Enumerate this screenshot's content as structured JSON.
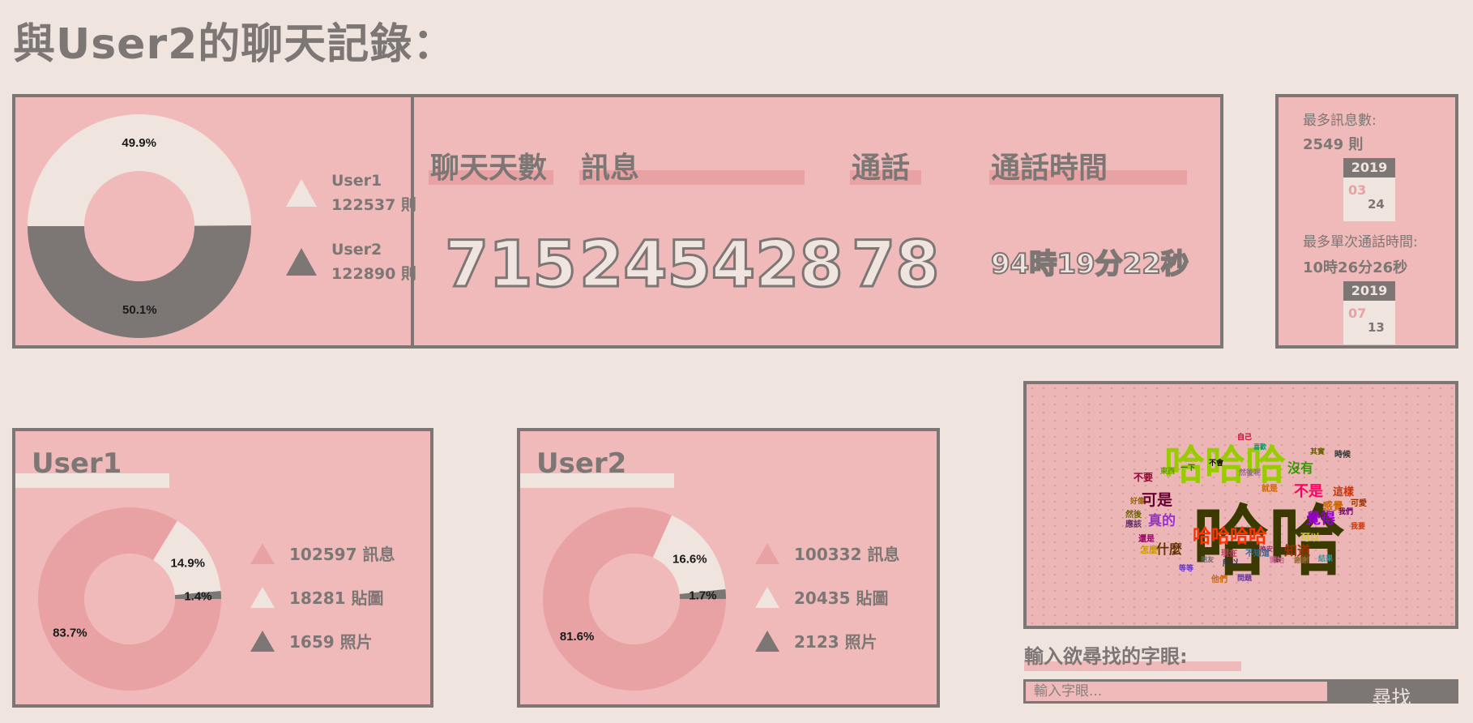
{
  "title": "與User2的聊天記錄：",
  "colors": {
    "background": "#f0e4df",
    "panel": "#f0baba",
    "dark": "#7c7675",
    "pink": "#e9a2a3",
    "cream": "#f0e4df"
  },
  "summary": {
    "donut": {
      "slices": [
        {
          "label": "49.9%",
          "value": 49.9,
          "color": "#f0e4df"
        },
        {
          "label": "50.1%",
          "value": 50.1,
          "color": "#7c7675"
        }
      ]
    },
    "legend": [
      {
        "name": "User1",
        "count": "122537 則",
        "icon": "triangle-icon"
      },
      {
        "name": "User2",
        "count": "122890 則",
        "icon": "triangle-icon"
      }
    ],
    "stats": [
      {
        "label": "聊天天數",
        "value": "715"
      },
      {
        "label": "訊息",
        "value": "245428"
      },
      {
        "label": "通話",
        "value": "78"
      },
      {
        "label": "通話時間",
        "value": "94時19分22秒"
      }
    ]
  },
  "max_panel": {
    "max_messages_label": "最多訊息數:",
    "max_messages_value": "2549 則",
    "max_messages_date": {
      "year": "2019",
      "month": "03",
      "day": "24"
    },
    "max_call_label": "最多單次通話時間:",
    "max_call_value": "10時26分26秒",
    "max_call_date": {
      "year": "2019",
      "month": "07",
      "day": "13"
    }
  },
  "users": [
    {
      "name": "User1",
      "donut": [
        {
          "label": "83.7%",
          "value": 83.7,
          "color": "#e9a2a3"
        },
        {
          "label": "14.9%",
          "value": 14.9,
          "color": "#f0e4df"
        },
        {
          "label": "1.4%",
          "value": 1.4,
          "color": "#7c7675"
        }
      ],
      "legend": [
        "102597 訊息",
        "18281 貼圖",
        "1659 照片"
      ]
    },
    {
      "name": "User2",
      "donut": [
        {
          "label": "81.6%",
          "value": 81.6,
          "color": "#e9a2a3"
        },
        {
          "label": "16.6%",
          "value": 16.6,
          "color": "#f0e4df"
        },
        {
          "label": "1.7%",
          "value": 1.7,
          "color": "#7c7675"
        }
      ],
      "legend": [
        "100332 訊息",
        "20435 貼圖",
        "2123 照片"
      ]
    }
  ],
  "word_cloud": {
    "words": [
      {
        "text": "哈哈",
        "color": "#3a3a00"
      },
      {
        "text": "哈哈哈",
        "color": "#99cc00"
      },
      {
        "text": "哈哈哈哈",
        "color": "#ff3300"
      },
      {
        "text": "可是",
        "color": "#660033"
      },
      {
        "text": "真的",
        "color": "#9933cc"
      },
      {
        "text": "覺得",
        "color": "#9900cc"
      },
      {
        "text": "不是",
        "color": "#ff0066"
      },
      {
        "text": "沒有",
        "color": "#339900"
      },
      {
        "text": "什麼",
        "color": "#663300"
      },
      {
        "text": "知道",
        "color": "#993300"
      },
      {
        "text": "感覺",
        "color": "#cc6600"
      },
      {
        "text": "這樣",
        "color": "#cc3300"
      },
      {
        "text": "不要",
        "color": "#990033"
      },
      {
        "text": "可以",
        "color": "#cccc33"
      },
      {
        "text": "時候",
        "color": "#333333"
      },
      {
        "text": "然後",
        "color": "#666600"
      },
      {
        "text": "應該",
        "color": "#663366"
      },
      {
        "text": "還是",
        "color": "#990066"
      },
      {
        "text": "怎麼",
        "color": "#cc9900"
      },
      {
        "text": "自己",
        "color": "#cc0033"
      },
      {
        "text": "我們",
        "color": "#660066"
      },
      {
        "text": "他們",
        "color": "#cc6600"
      },
      {
        "text": "所以",
        "color": "#333333"
      },
      {
        "text": "不會",
        "color": "#000000"
      },
      {
        "text": "我要",
        "color": "#cc3300"
      },
      {
        "text": "好像",
        "color": "#996600"
      },
      {
        "text": "就是",
        "color": "#cc6600"
      },
      {
        "text": "可愛",
        "color": "#993300"
      },
      {
        "text": "其實",
        "color": "#666600"
      },
      {
        "text": "一下",
        "color": "#336600"
      },
      {
        "text": "問題",
        "color": "#663399"
      },
      {
        "text": "晚安",
        "color": "#993366"
      },
      {
        "text": "朋友",
        "color": "#666666"
      },
      {
        "text": "喜歡",
        "color": "#009966"
      },
      {
        "text": "開始",
        "color": "#cc6699"
      },
      {
        "text": "不知道",
        "color": "#336699"
      },
      {
        "text": "謝謝",
        "color": "#996633"
      },
      {
        "text": "東西",
        "color": "#669900"
      },
      {
        "text": "現在",
        "color": "#cc3366"
      },
      {
        "text": "等等",
        "color": "#6633cc"
      },
      {
        "text": "結果",
        "color": "#339999"
      },
      {
        "text": "然後呢",
        "color": "#996699"
      }
    ]
  },
  "search": {
    "label": "輸入欲尋找的字眼:",
    "placeholder": "輸入字眼...",
    "button": "尋找"
  }
}
